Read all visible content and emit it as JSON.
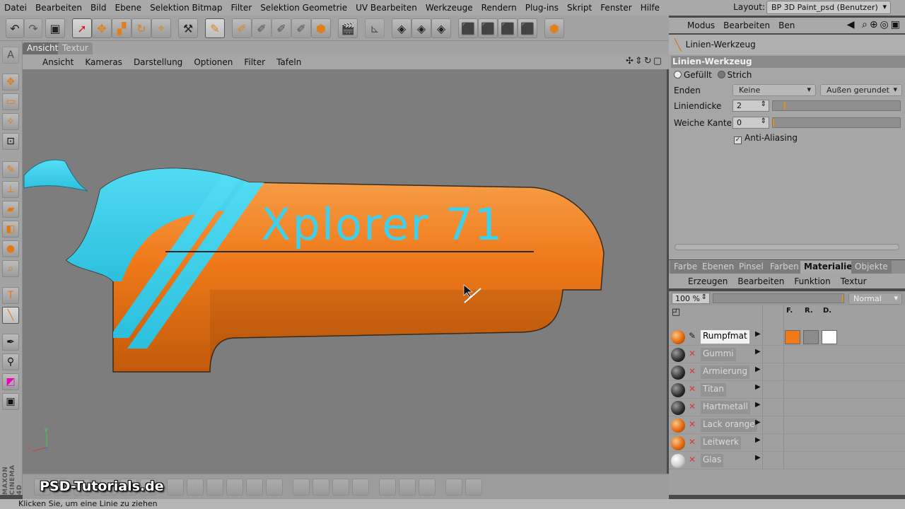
{
  "menubar": {
    "items": [
      "Datei",
      "Bearbeiten",
      "Bild",
      "Ebene",
      "Selektion Bitmap",
      "Filter",
      "Selektion Geometrie",
      "UV Bearbeiten",
      "Werkzeuge",
      "Rendern",
      "Plug-ins",
      "Skript",
      "Fenster",
      "Hilfe"
    ],
    "layout_label": "Layout:",
    "layout_value": "BP 3D Paint_psd (Benutzer)"
  },
  "viewport": {
    "tabs": [
      "Ansicht",
      "Textur"
    ],
    "menu": [
      "Ansicht",
      "Kameras",
      "Darstellung",
      "Optionen",
      "Filter",
      "Tafeln"
    ],
    "nav_icons": "✣⇕↻▢",
    "model_text": "Xplorer 71",
    "axis_labels": {
      "x": "x",
      "y": "y",
      "z": "z"
    }
  },
  "attributes": {
    "menu": [
      "Modus",
      "Bearbeiten",
      "Ben"
    ],
    "tool_name": "Linien-Werkzeug",
    "section_title": "Linien-Werkzeug",
    "radio_filled": "Gefüllt",
    "radio_stroke": "Strich",
    "ends_label": "Enden",
    "ends_value": "Keine",
    "ends_value2": "Außen gerundet",
    "width_label": "Liniendicke",
    "width_value": "2",
    "width_fraction": 0.09,
    "soft_label": "Weiche Kanten",
    "soft_value": "0",
    "soft_fraction": 0.0,
    "antialias_label": "Anti-Aliasing"
  },
  "materials": {
    "tabs": [
      "Farbe",
      "Ebenen",
      "Pinsel",
      "Farben",
      "Materialien",
      "Objekte"
    ],
    "active_tab": "Materialien",
    "menu": [
      "Erzeugen",
      "Bearbeiten",
      "Funktion",
      "Textur"
    ],
    "zoom": "100 %",
    "mode": "Normal",
    "channel_headers": [
      "F.",
      "R.",
      "D."
    ],
    "items": [
      {
        "name": "Rumpfmat",
        "ball": "orange",
        "selected": true
      },
      {
        "name": "Gummi",
        "ball": "dark",
        "selected": false
      },
      {
        "name": "Armierung",
        "ball": "dark",
        "selected": false
      },
      {
        "name": "Titan",
        "ball": "dark",
        "selected": false
      },
      {
        "name": "Hartmetall",
        "ball": "dark",
        "selected": false
      },
      {
        "name": "Lack orange",
        "ball": "orange",
        "selected": false
      },
      {
        "name": "Leitwerk",
        "ball": "orange",
        "selected": false
      },
      {
        "name": "Glas",
        "ball": "glass",
        "selected": false
      }
    ],
    "swatch_colors": [
      "#f07a1a",
      "#8c8c8c",
      "#ffffff"
    ]
  },
  "branding": {
    "watermark": "PSD-Tutorials.de",
    "vertical_logo": "MAXON CINEMA 4D"
  },
  "status": {
    "text": "Klicken Sie, um eine Linie zu ziehen"
  },
  "colors": {
    "accent_orange": "#f07a1a",
    "cyan": "#3fd3ee",
    "viewport_bg": "#7d7d7d"
  }
}
